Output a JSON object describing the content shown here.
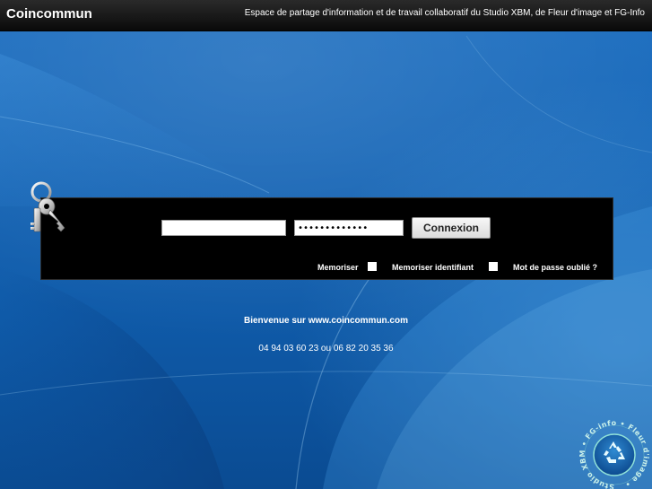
{
  "header": {
    "brand": "Coincommun",
    "tagline": "Espace de partage d'information et de travail collaboratif du Studio XBM, de Fleur d'image et FG-Info"
  },
  "login": {
    "username_value": "",
    "password_value": "•••••••••••••",
    "submit_label": "Connexion",
    "remember_label": "Memoriser",
    "remember_id_label": "Memoriser identifiant",
    "forgot_link": "Mot de passe oublié ?"
  },
  "footer": {
    "welcome": "Bienvenue sur www.coincommun.com",
    "phone": "04 94 03 60 23 ou 06 82 20 35 36"
  },
  "logo": {
    "ring_text": "Studio XBM • FG-info • Fleur d'image •",
    "icon": "recycle-icon"
  },
  "colors": {
    "background": "#1767b8",
    "bar": "#0a0a0a",
    "panel": "#000000"
  }
}
